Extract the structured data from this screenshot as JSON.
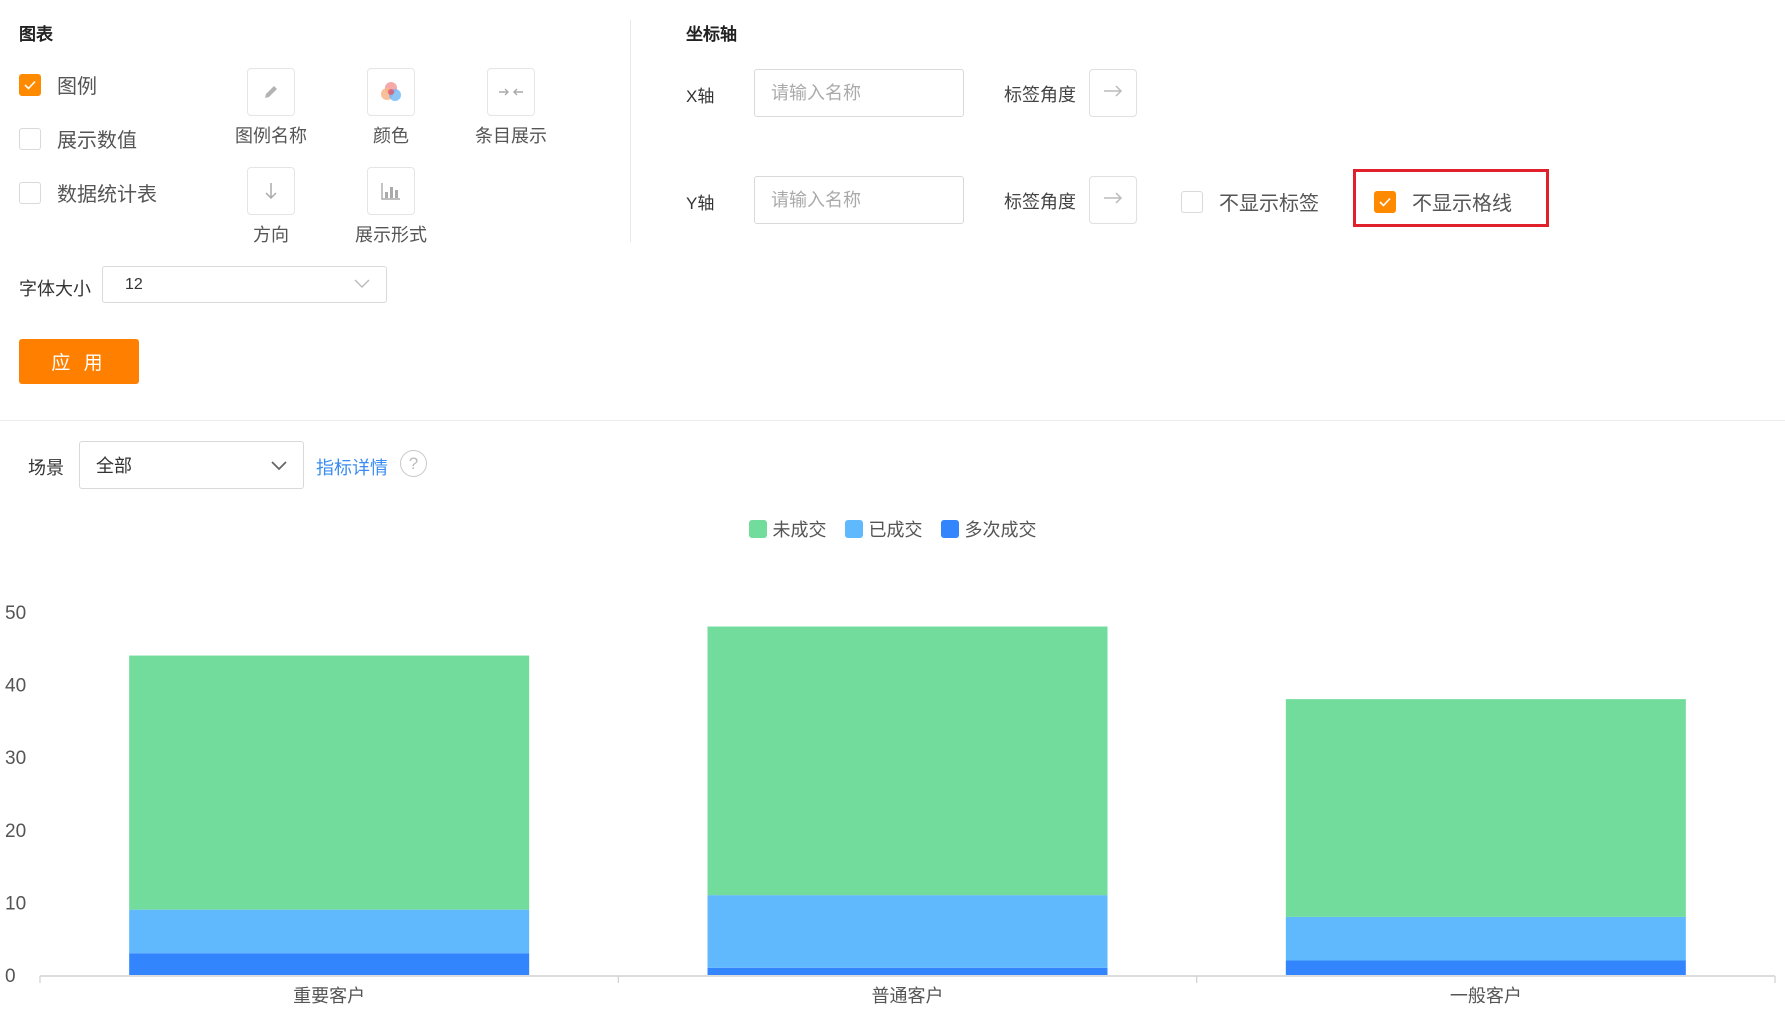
{
  "chart_panel": {
    "title": "图表",
    "checkboxes": [
      {
        "label": "图例",
        "checked": true
      },
      {
        "label": "展示数值",
        "checked": false
      },
      {
        "label": "数据统计表",
        "checked": false
      }
    ],
    "tools": [
      {
        "label": "图例名称",
        "icon": "pencil-icon"
      },
      {
        "label": "颜色",
        "icon": "color-palette-icon"
      },
      {
        "label": "条目展示",
        "icon": "collapse-arrows-icon"
      },
      {
        "label": "方向",
        "icon": "arrow-down-icon"
      },
      {
        "label": "展示形式",
        "icon": "bar-chart-icon"
      }
    ],
    "font_size_label": "字体大小",
    "font_size_value": "12",
    "apply_label": "应 用"
  },
  "axis_panel": {
    "title": "坐标轴",
    "x_axis": {
      "label": "X轴",
      "placeholder": "请输入名称",
      "angle_label": "标签角度"
    },
    "y_axis": {
      "label": "Y轴",
      "placeholder": "请输入名称",
      "angle_label": "标签角度",
      "hide_labels": {
        "label": "不显示标签",
        "checked": false
      },
      "hide_gridlines": {
        "label": "不显示格线",
        "checked": true
      }
    }
  },
  "filter": {
    "scene_label": "场景",
    "scene_value": "全部",
    "detail_link": "指标详情",
    "help_icon": "?"
  },
  "colors": {
    "accent": "#ff8000",
    "series_not_closed": "#72dc9d",
    "series_closed": "#60b8fd",
    "series_multi": "#3385fd"
  },
  "chart_data": {
    "type": "bar",
    "stacked": true,
    "categories": [
      "重要客户",
      "普通客户",
      "一般客户"
    ],
    "series": [
      {
        "name": "多次成交",
        "values": [
          3,
          1,
          2
        ]
      },
      {
        "name": "已成交",
        "values": [
          6,
          10,
          6
        ]
      },
      {
        "name": "未成交",
        "values": [
          35,
          37,
          30
        ]
      }
    ],
    "legend": [
      "未成交",
      "已成交",
      "多次成交"
    ],
    "legend_position": "top",
    "ylim": [
      0,
      50
    ],
    "yticks": [
      0,
      10,
      20,
      30,
      40,
      50
    ],
    "grid": false,
    "xlabel": "",
    "ylabel": ""
  }
}
